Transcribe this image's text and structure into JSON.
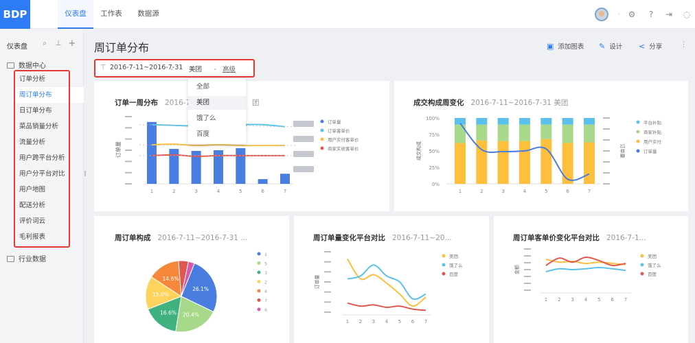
{
  "app": {
    "logo": "BDP"
  },
  "nav": {
    "tabs": [
      {
        "label": "仪表盘"
      },
      {
        "label": "工作表"
      },
      {
        "label": "数据源"
      }
    ]
  },
  "sidebar": {
    "title": "仪表盘",
    "folders": [
      {
        "label": "数据中心"
      },
      {
        "label": "行业数据"
      }
    ],
    "items": [
      {
        "label": "订单分析"
      },
      {
        "label": "周订单分布"
      },
      {
        "label": "日订单分布"
      },
      {
        "label": "菜品销量分析"
      },
      {
        "label": "流量分析"
      },
      {
        "label": "用户跨平台分析"
      },
      {
        "label": "用户分平台对比"
      },
      {
        "label": "用户地图"
      },
      {
        "label": "配送分析"
      },
      {
        "label": "评价词云"
      },
      {
        "label": "毛利报表"
      }
    ],
    "active_index": 1
  },
  "header": {
    "title": "周订单分布",
    "add_chart_label": "添加图表",
    "design_label": "设计",
    "share_label": "分享"
  },
  "filter": {
    "date_range": "2016-7-11~2016-7-31",
    "platform": "美团",
    "advanced_label": "高级"
  },
  "dropdown": {
    "options": [
      {
        "label": "全部"
      },
      {
        "label": "美团"
      },
      {
        "label": "饿了么"
      },
      {
        "label": "百度"
      }
    ],
    "selected_index": 1
  },
  "colors": {
    "accent": "#2d7cf6",
    "blue": "#4a7de0",
    "cyan": "#5bc0eb",
    "orange": "#fdbf3c",
    "red": "#e0574f",
    "green": "#a8d98a",
    "highlight": "#e53935"
  },
  "cards": {
    "weekly": {
      "title": "订单一周分布",
      "sub": "2016-7-",
      "sub_tail": "团",
      "ylabel": "订单量",
      "legend": [
        "订单量",
        "订单客单价",
        "用户实付客单价",
        "商家实收客单价"
      ]
    },
    "composition": {
      "title": "成交构成周变化",
      "sub": "2016-7-11~2016-7-31  美团",
      "ylabel_left": "成交构成",
      "ylabel_right": "订单量",
      "legend": [
        "平台补贴",
        "商家补贴",
        "用户实付",
        "订单量"
      ]
    },
    "pie": {
      "title": "周订单构成",
      "sub": "2016-7-11~2016-7-31  ...",
      "legend": [
        "1",
        "5",
        "3",
        "2",
        "4",
        "7",
        "6"
      ]
    },
    "platform_orders": {
      "title": "周订单量变化平台对比",
      "sub": "2016-7-11~20...",
      "ylabel": "订单量",
      "legend": [
        "美团",
        "饿了么",
        "百度"
      ]
    },
    "platform_price": {
      "title": "周订单客单价变化平台对比",
      "sub": "2016-7-1...",
      "ylabel": "金额",
      "legend": [
        "美团",
        "饿了么",
        "百度"
      ]
    }
  },
  "chart_data": [
    {
      "type": "bar",
      "title": "订单一周分布",
      "categories": [
        "1",
        "2",
        "3",
        "4",
        "5",
        "6",
        "7"
      ],
      "ylabel": "订单量",
      "series": [
        {
          "name": "订单量",
          "type": "bar",
          "values": [
            92,
            52,
            49,
            50,
            53,
            7,
            15
          ]
        },
        {
          "name": "订单客单价",
          "type": "line",
          "values": [
            88,
            87,
            86,
            87,
            88,
            88,
            85
          ]
        },
        {
          "name": "用户实付客单价",
          "type": "line",
          "values": [
            58,
            59,
            57,
            58,
            57,
            57,
            57
          ]
        },
        {
          "name": "商家实收客单价",
          "type": "line",
          "values": [
            42,
            43,
            41,
            42,
            42,
            42,
            42
          ]
        }
      ]
    },
    {
      "type": "bar",
      "title": "成交构成周变化",
      "categories": [
        "1",
        "2",
        "3",
        "4",
        "5",
        "6",
        "7"
      ],
      "ylim": [
        0,
        100
      ],
      "y_ticks": [
        "100%",
        "75%",
        "50%",
        "25%",
        "0%"
      ],
      "series": [
        {
          "name": "用户实付",
          "values": [
            62,
            66,
            65,
            65,
            68,
            62,
            63
          ]
        },
        {
          "name": "商家补贴",
          "values": [
            28,
            24,
            25,
            25,
            22,
            28,
            27
          ]
        },
        {
          "name": "平台补贴",
          "values": [
            10,
            10,
            10,
            10,
            10,
            10,
            10
          ]
        },
        {
          "name": "订单量",
          "type": "line",
          "values": [
            92,
            52,
            49,
            50,
            53,
            7,
            15
          ]
        }
      ]
    },
    {
      "type": "pie",
      "title": "周订单构成",
      "labels": [
        "1",
        "5",
        "3",
        "2",
        "4",
        "7",
        "6"
      ],
      "values": [
        26.1,
        20.4,
        16.6,
        15.0,
        14.6,
        4.5,
        2.8
      ],
      "data_labels": [
        "26.1%",
        "20.4%",
        "16.6%",
        "15.0%",
        "14.6%",
        "",
        ""
      ]
    },
    {
      "type": "line",
      "title": "周订单量变化平台对比",
      "x": [
        "1",
        "2",
        "3",
        "4",
        "5",
        "6",
        "7"
      ],
      "series": [
        {
          "name": "美团",
          "values": [
            88,
            55,
            62,
            48,
            30,
            10,
            25
          ]
        },
        {
          "name": "饿了么",
          "values": [
            55,
            60,
            78,
            60,
            50,
            22,
            30
          ]
        },
        {
          "name": "百度",
          "values": [
            15,
            10,
            12,
            8,
            10,
            5,
            3
          ]
        }
      ]
    },
    {
      "type": "line",
      "title": "周订单客单价变化平台对比",
      "x": [
        "1",
        "2",
        "3",
        "4",
        "5",
        "6",
        "7"
      ],
      "series": [
        {
          "name": "美团",
          "values": [
            75,
            68,
            70,
            65,
            68,
            65,
            62
          ]
        },
        {
          "name": "饿了么",
          "values": [
            45,
            52,
            50,
            52,
            55,
            52,
            48
          ]
        },
        {
          "name": "百度",
          "values": [
            60,
            78,
            68,
            80,
            72,
            60,
            65
          ]
        }
      ]
    }
  ]
}
